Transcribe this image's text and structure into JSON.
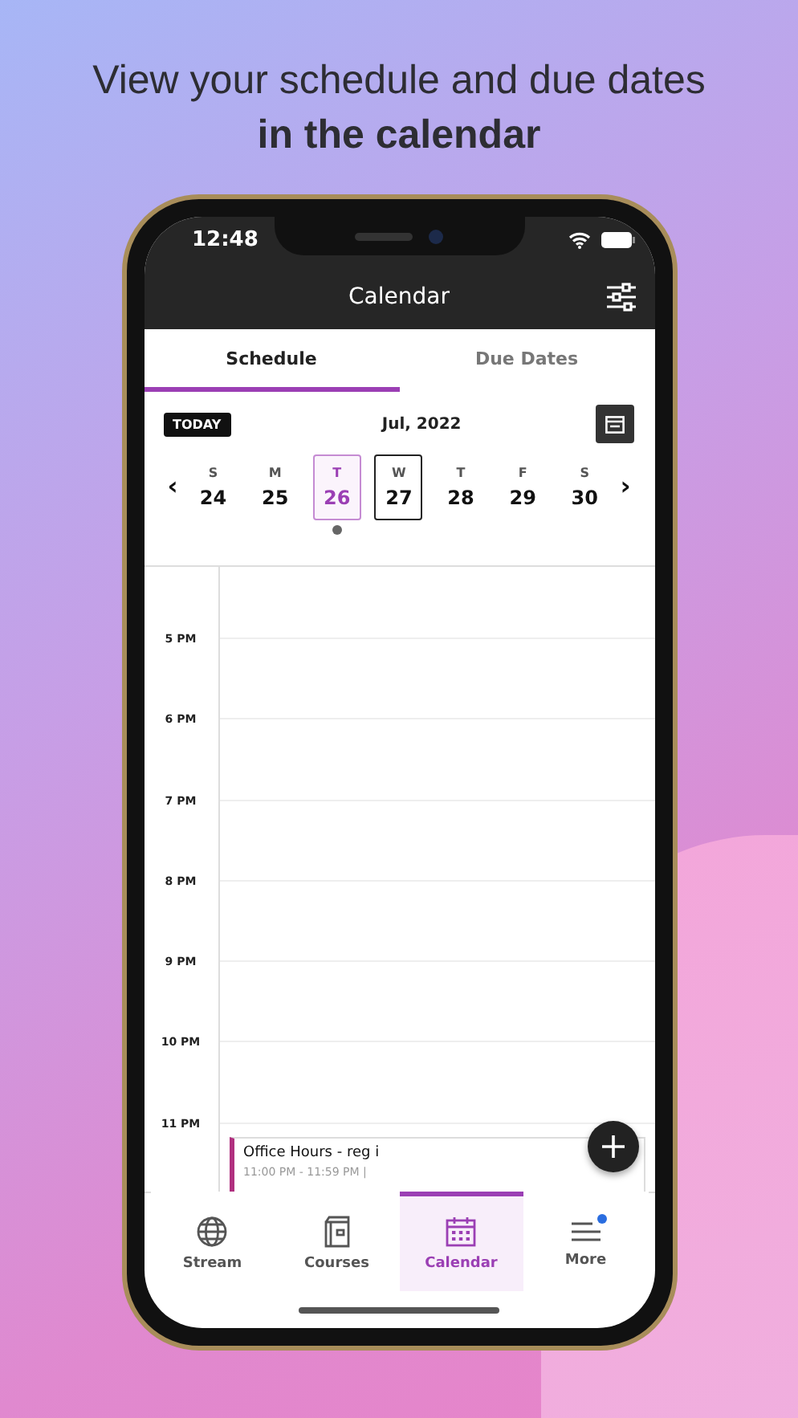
{
  "headline": {
    "line_1": "View your schedule and due dates",
    "line_2": "in the calendar"
  },
  "status_bar": {
    "time": "12:48"
  },
  "nav_bar": {
    "title": "Calendar"
  },
  "tabs": [
    {
      "label": "Schedule",
      "selected": true
    },
    {
      "label": "Due Dates",
      "selected": false
    }
  ],
  "calendar_header": {
    "today_button": "TODAY",
    "month": "Jul, 2022",
    "previous_arrow": "‹",
    "next_arrow": "›"
  },
  "days": [
    {
      "letter": "S",
      "number": "24",
      "today": false,
      "selected": false,
      "has_events": false
    },
    {
      "letter": "M",
      "number": "25",
      "today": false,
      "selected": false,
      "has_events": false
    },
    {
      "letter": "T",
      "number": "26",
      "today": true,
      "selected": false,
      "has_events": true
    },
    {
      "letter": "W",
      "number": "27",
      "today": false,
      "selected": true,
      "has_events": false
    },
    {
      "letter": "T",
      "number": "28",
      "today": false,
      "selected": false,
      "has_events": false
    },
    {
      "letter": "F",
      "number": "29",
      "today": false,
      "selected": false,
      "has_events": false
    },
    {
      "letter": "S",
      "number": "30",
      "today": false,
      "selected": false,
      "has_events": false
    }
  ],
  "hours": [
    "5 PM",
    "6 PM",
    "7 PM",
    "8 PM",
    "9 PM",
    "10 PM",
    "11 PM"
  ],
  "event": {
    "title": "Office Hours - reg i",
    "time": "11:00 PM - 11:59 PM |"
  },
  "bottom_tabs": [
    {
      "label": "Stream",
      "selected": false,
      "badge": false
    },
    {
      "label": "Courses",
      "selected": false,
      "badge": false
    },
    {
      "label": "Calendar",
      "selected": true,
      "badge": false
    },
    {
      "label": "More",
      "selected": false,
      "badge": true
    }
  ]
}
